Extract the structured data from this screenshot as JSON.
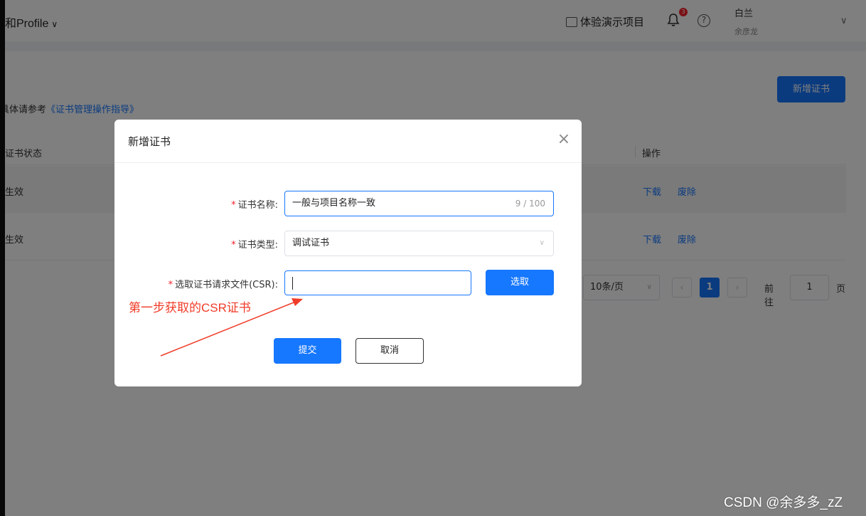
{
  "header": {
    "app_title": "和Profile",
    "demo_project": "体验演示项目",
    "notification_count": "3",
    "help_glyph": "?",
    "user_name": "白兰",
    "user_sub": "余彦龙"
  },
  "toolbar": {
    "add_cert_label": "新增证书"
  },
  "reference": {
    "prefix": "具体请参考",
    "link": "《证书管理操作指导》"
  },
  "table": {
    "columns": {
      "status": "证书状态",
      "operations": "操作"
    },
    "rows": [
      {
        "status": "生效",
        "download": "下载",
        "abolish": "废除"
      },
      {
        "status": "生效",
        "download": "下载",
        "abolish": "废除"
      }
    ]
  },
  "pagination": {
    "page_size": "10条/页",
    "prev": "‹",
    "current_page": "1",
    "next": "›",
    "goto_label": "前往",
    "goto_value": "1",
    "goto_suffix": "页"
  },
  "modal": {
    "title": "新增证书",
    "close_glyph": "×",
    "required_mark": "*",
    "name_label": "证书名称:",
    "name_value": "一般与项目名称一致",
    "name_count": "9 / 100",
    "type_label": "证书类型:",
    "type_value": "调试证书",
    "csr_label": "选取证书请求文件(CSR):",
    "select_button": "选取",
    "submit_button": "提交",
    "cancel_button": "取消"
  },
  "annotation": {
    "text": "第一步获取的CSR证书",
    "color": "#f03c28"
  },
  "watermark": "CSDN @余多多_zZ",
  "colors": {
    "primary": "#1677ff",
    "danger": "#f5222d"
  },
  "icons": {
    "demo": "presentation-icon",
    "bell": "bell-icon",
    "help": "help-circle-icon",
    "close": "close-icon",
    "chevron": "chevron-down-icon"
  }
}
